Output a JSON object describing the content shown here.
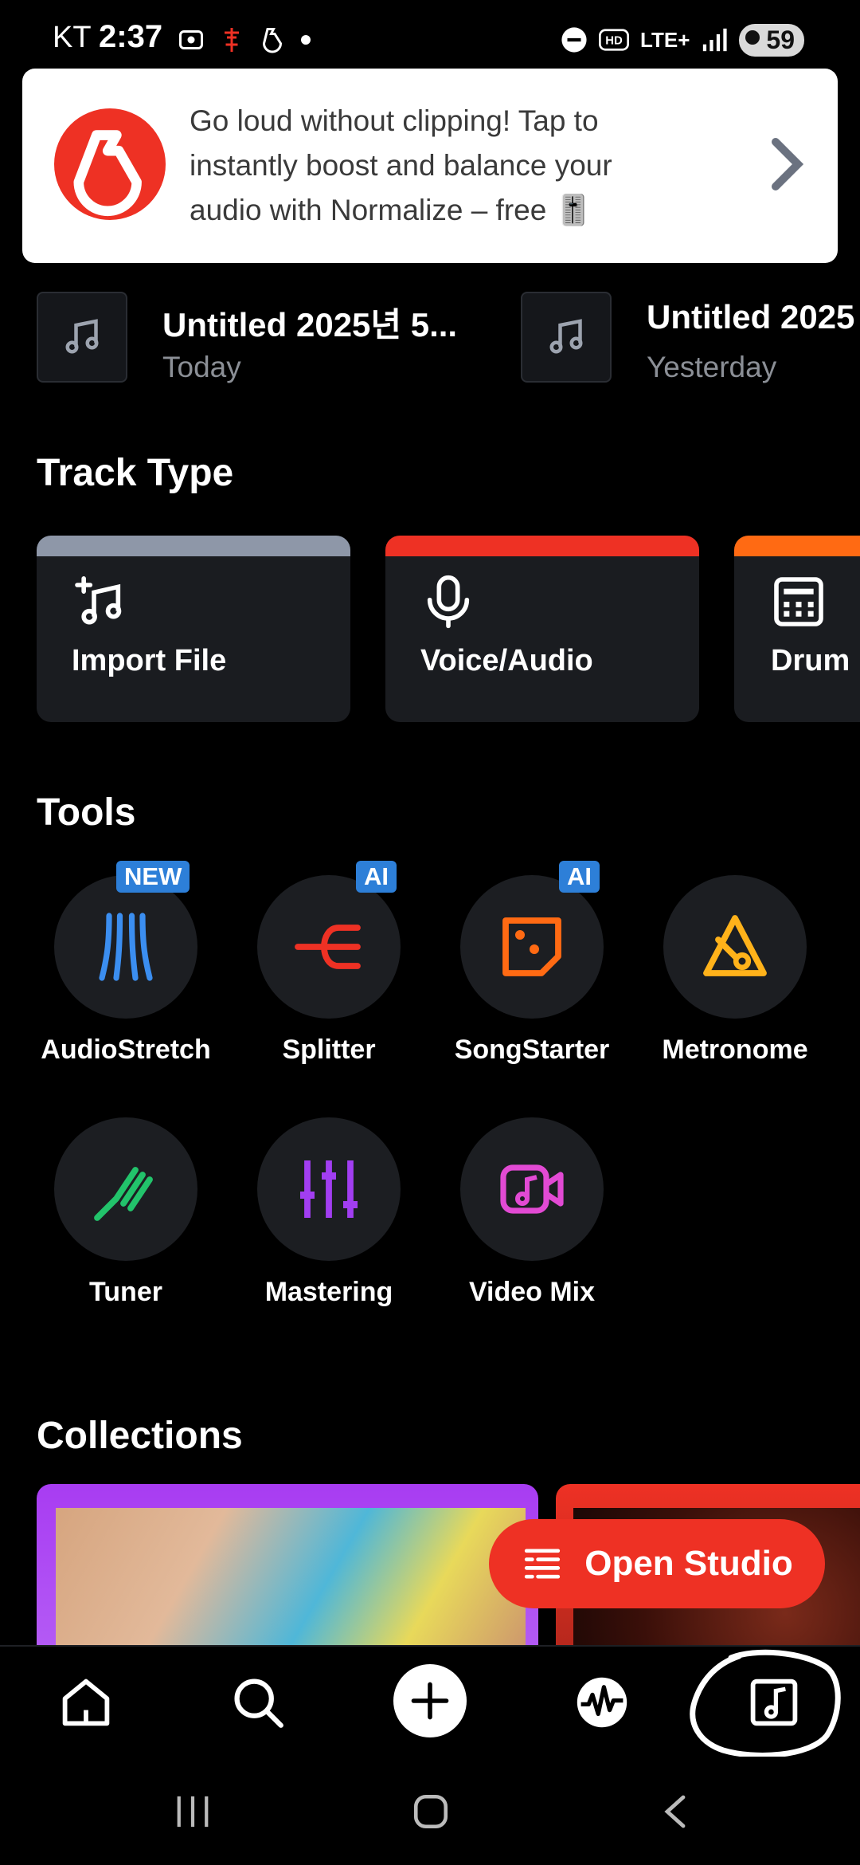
{
  "status_bar": {
    "carrier": "KT",
    "time": "2:37",
    "network": "LTE+",
    "battery": "59"
  },
  "banner": {
    "text": "Go loud without clipping! Tap to instantly boost and balance your audio with Normalize – free 🎚️"
  },
  "recent": [
    {
      "title": "Untitled 2025년 5...",
      "subtitle": "Today"
    },
    {
      "title": "Untitled 2025",
      "subtitle": "Yesterday"
    }
  ],
  "track_type": {
    "title": "Track Type",
    "cards": [
      {
        "label": "Import File",
        "color": "#8e97a8"
      },
      {
        "label": "Voice/Audio",
        "color": "#ee3124"
      },
      {
        "label": "Drum M",
        "color": "#ff6a13"
      }
    ]
  },
  "tools": {
    "title": "Tools",
    "items": [
      {
        "label": "AudioStretch",
        "badge": "NEW",
        "color": "#3b8ef0"
      },
      {
        "label": "Splitter",
        "badge": "AI",
        "color": "#ee3124"
      },
      {
        "label": "SongStarter",
        "badge": "AI",
        "color": "#ff6a13"
      },
      {
        "label": "Metronome",
        "badge": "",
        "color": "#ffb21a"
      },
      {
        "label": "Tuner",
        "badge": "",
        "color": "#22c36b"
      },
      {
        "label": "Mastering",
        "badge": "",
        "color": "#a23ef2"
      },
      {
        "label": "Video Mix",
        "badge": "",
        "color": "#e24ad4"
      }
    ]
  },
  "collections": {
    "title": "Collections"
  },
  "open_studio": {
    "label": "Open Studio"
  },
  "bottom_nav": {
    "items": [
      "home-icon",
      "search-icon",
      "add-icon",
      "waveform-icon",
      "library-icon"
    ]
  }
}
